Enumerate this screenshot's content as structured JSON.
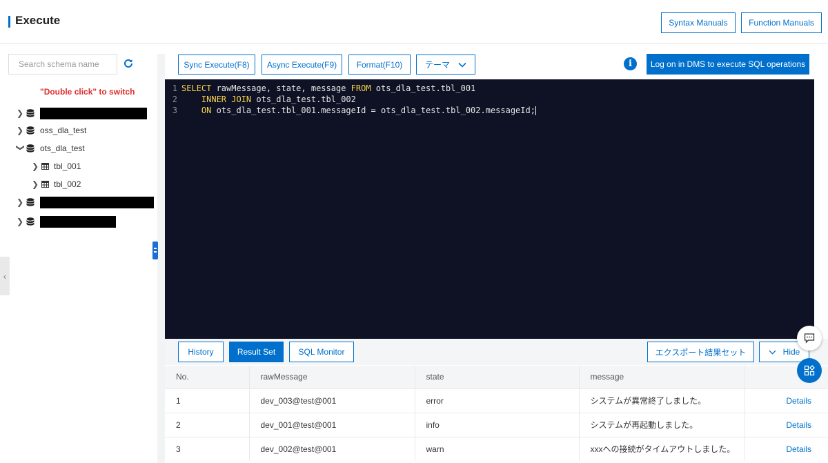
{
  "header": {
    "title": "Execute",
    "syntax_manuals": "Syntax Manuals",
    "function_manuals": "Function Manuals"
  },
  "sidebar": {
    "search_placeholder": "Search schema name",
    "hint": "\"Double click\" to switch",
    "databases": [
      {
        "label": "",
        "redacted": true
      },
      {
        "label": "oss_dla_test"
      },
      {
        "label": "ots_dla_test",
        "expanded": true,
        "tables": [
          "tbl_001",
          "tbl_002"
        ]
      },
      {
        "label": "",
        "redacted": true
      },
      {
        "label": "",
        "redacted": true
      }
    ]
  },
  "toolbar": {
    "sync_execute": "Sync Execute(F8)",
    "async_execute": "Async Execute(F9)",
    "format": "Format(F10)",
    "theme": "テーマ",
    "dms_login": "Log on in DMS to execute SQL operations"
  },
  "editor": {
    "lines": [
      {
        "num": "1",
        "kw1": "SELECT",
        "text1": " rawMessage, state, message ",
        "kw2": "FROM",
        "text2": " ots_dla_test.tbl_001"
      },
      {
        "num": "2",
        "indent": "    ",
        "kw1": "INNER JOIN",
        "text1": " ots_dla_test.tbl_002"
      },
      {
        "num": "3",
        "indent": "    ",
        "kw1": "ON",
        "text1": " ots_dla_test.tbl_001.messageId = ots_dla_test.tbl_002.messageId;"
      }
    ]
  },
  "results": {
    "tabs": [
      "History",
      "Result Set",
      "SQL Monitor"
    ],
    "export": "エクスポート結果セット",
    "hide": "Hide",
    "columns": [
      "No.",
      "rawMessage",
      "state",
      "message",
      ""
    ],
    "rows": [
      {
        "no": "1",
        "raw": "dev_003@test@001",
        "state": "error",
        "message": "システムが異常終了しました。",
        "action": "Details"
      },
      {
        "no": "2",
        "raw": "dev_001@test@001",
        "state": "info",
        "message": "システムが再起動しました。",
        "action": "Details"
      },
      {
        "no": "3",
        "raw": "dev_002@test@001",
        "state": "warn",
        "message": "xxxへの接続がタイムアウトしました。",
        "action": "Details"
      }
    ]
  },
  "colors": {
    "accent": "#0070cc",
    "editor_bg": "#0f1224",
    "keyword": "#f6d34a",
    "hint": "#e02d2d"
  }
}
